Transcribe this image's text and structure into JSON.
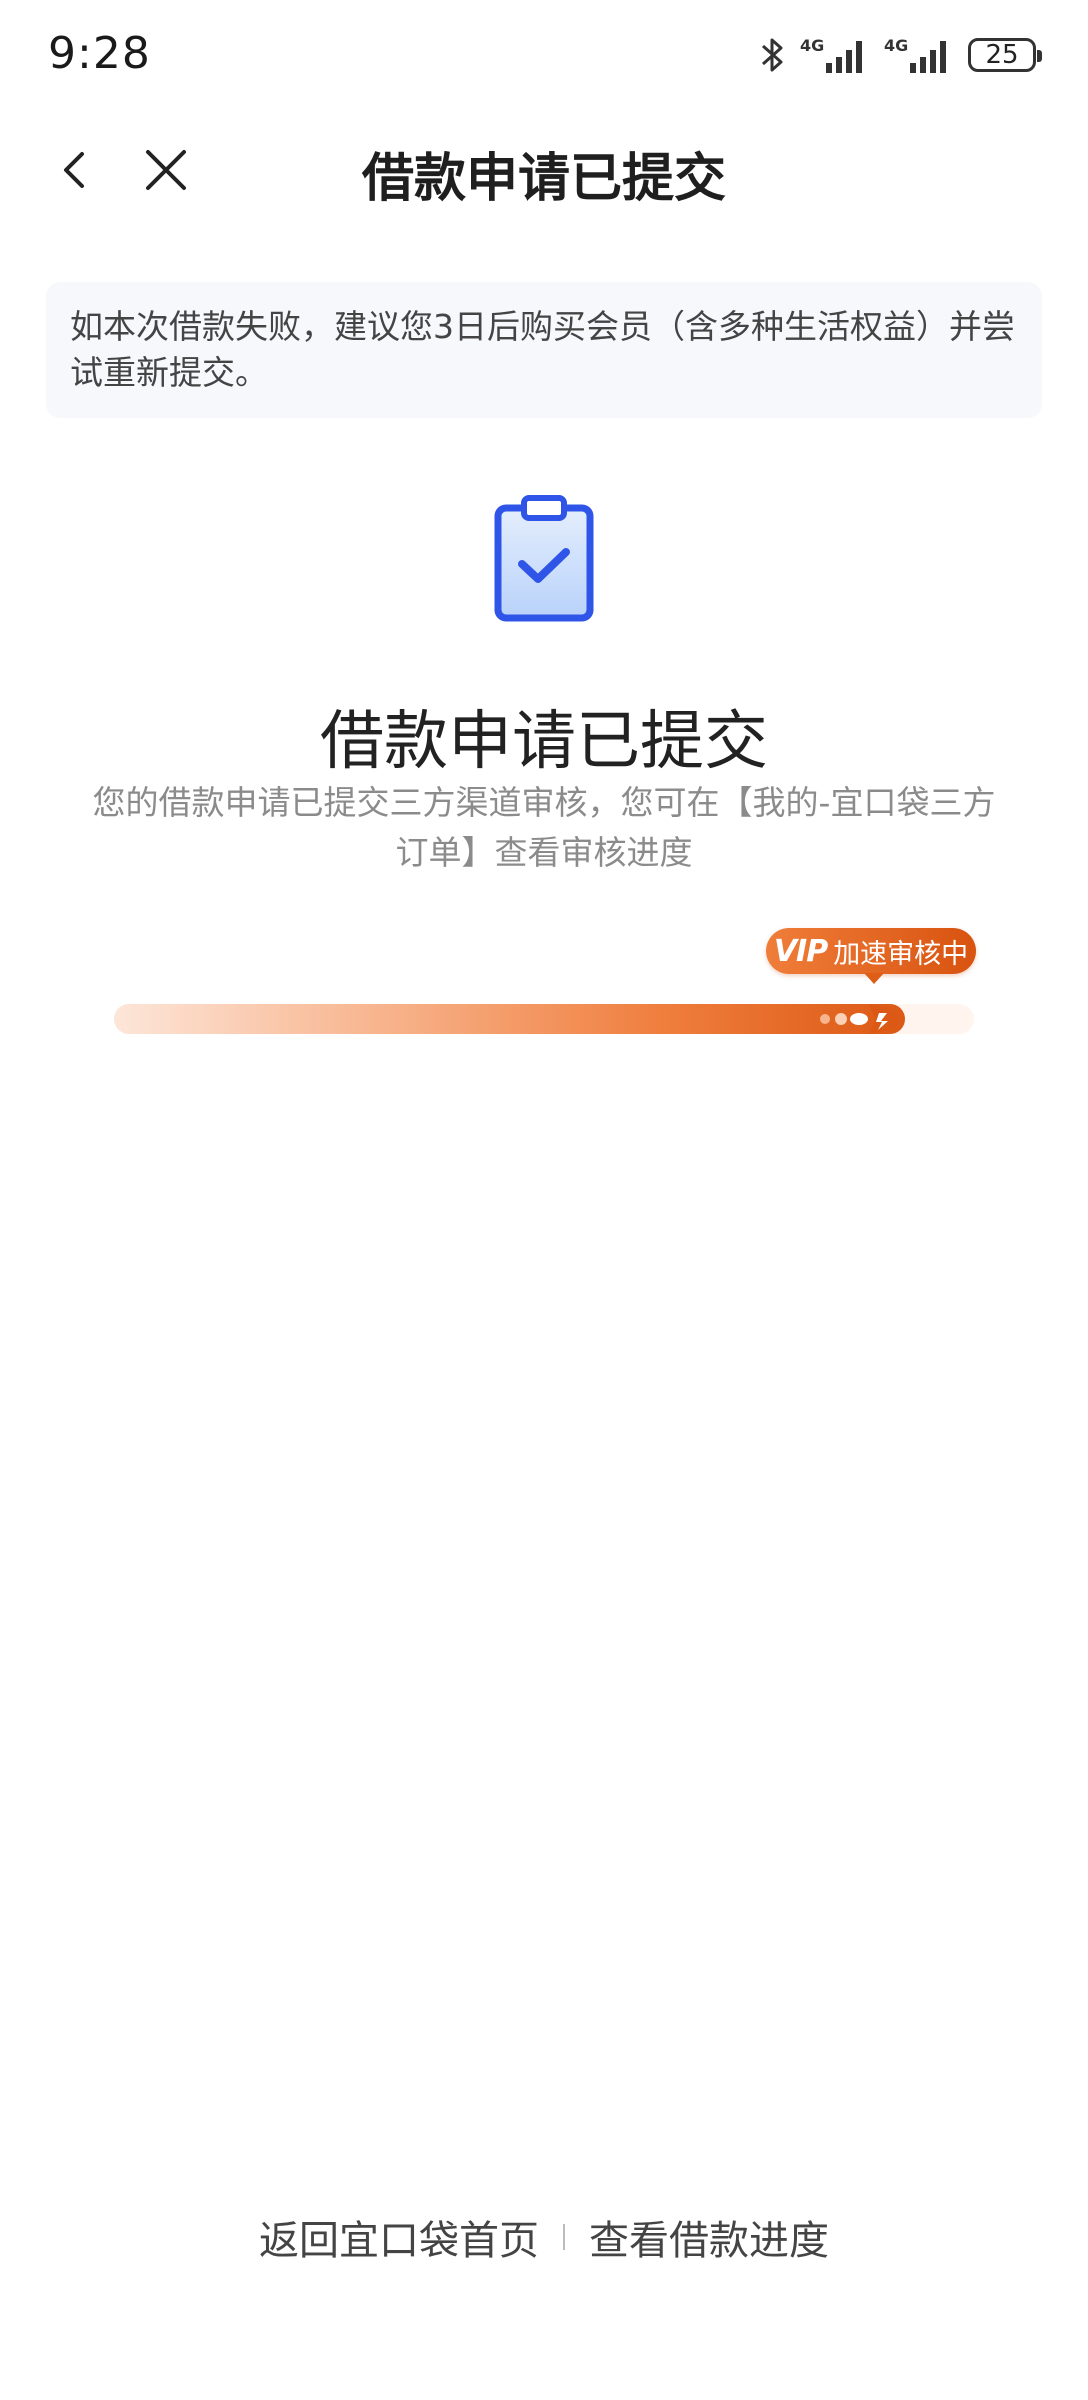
{
  "status_bar": {
    "time": "9:28",
    "network_1": "4G",
    "network_2": "4G",
    "battery": "25",
    "icons": [
      "bluetooth-icon",
      "signal-icon",
      "signal-icon",
      "battery-icon"
    ]
  },
  "header": {
    "title": "借款申请已提交",
    "back_icon": "chevron-left-icon",
    "close_icon": "close-icon"
  },
  "notice": {
    "text": "如本次借款失败，建议您3日后购买会员（含多种生活权益）并尝试重新提交。"
  },
  "result": {
    "icon": "clipboard-check-icon",
    "title": "借款申请已提交",
    "subtitle": "您的借款申请已提交三方渠道审核，您可在【我的-宜口袋三方订单】查看审核进度"
  },
  "progress": {
    "badge_logo": "VIP",
    "badge_text": "加速审核中",
    "level": 0.92,
    "colors": {
      "accent": "#e0621c",
      "light": "#fde6d9",
      "track": "#fff5ee"
    }
  },
  "footer": {
    "home_link": "返回宜口袋首页",
    "progress_link": "查看借款进度"
  },
  "colors": {
    "icon_blue": "#2f55e8",
    "icon_fill": "#cfe0fb"
  }
}
